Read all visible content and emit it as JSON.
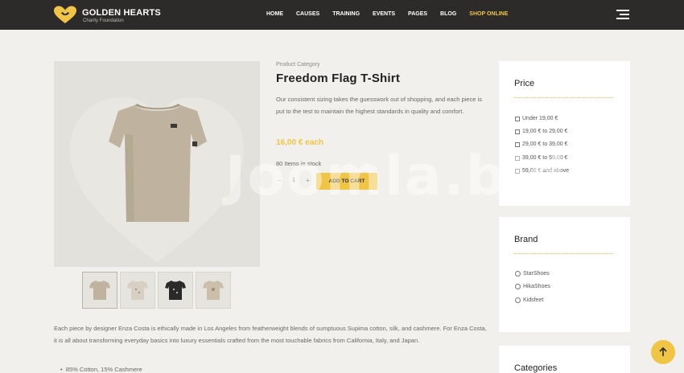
{
  "header": {
    "logo_title": "GOLDEN HEARTS",
    "logo_subtitle": "Charity Foundation",
    "nav": [
      "HOME",
      "CAUSES",
      "TRAINING",
      "EVENTS",
      "PAGES",
      "BLOG",
      "SHOP ONLINE"
    ],
    "active_nav": "SHOP ONLINE",
    "menu_icon": "hamburger-icon"
  },
  "product": {
    "category": "Product Category",
    "title": "Freedom Flag T-Shirt",
    "description": "Our consistent sizing takes the guesswork out of shopping, and each piece is put to the test to maintain the highest standards in quality and comfort.",
    "price": "16,00 € each",
    "stock": "80 Items in stock",
    "quantity": "1",
    "minus": "−",
    "plus": "+",
    "add_to_cart": "ADD TO CART"
  },
  "sidebar": {
    "price": {
      "title": "Price",
      "options": [
        "Under 19,00 €",
        "19,00 € to 29,00 €",
        "29,00 € to 39,00 €",
        "39,00 € to 59,00 €",
        "59,00 € and above"
      ]
    },
    "brand": {
      "title": "Brand",
      "options": [
        "StarShoes",
        "HikaShoes",
        "Kidsfeet"
      ]
    },
    "categories": {
      "title": "Categories"
    }
  },
  "details": {
    "paragraph": "Each piece by designer Enza Costa is ethically made in Los Angeles from featherweight blends of sumptuous Supima cotton, silk, and cashmere. For Enza Costa, it is all about transforming everyday basics into luxury essentials crafted from the most touchable fabrics from California, Italy, and Japan.",
    "bullets": [
      "85% Cotton, 15% Cashmere"
    ]
  },
  "watermark": "Joomla.bid",
  "colors": {
    "accent": "#f0c445",
    "header_bg": "#2c2b29",
    "page_bg": "#f2f0ec"
  }
}
